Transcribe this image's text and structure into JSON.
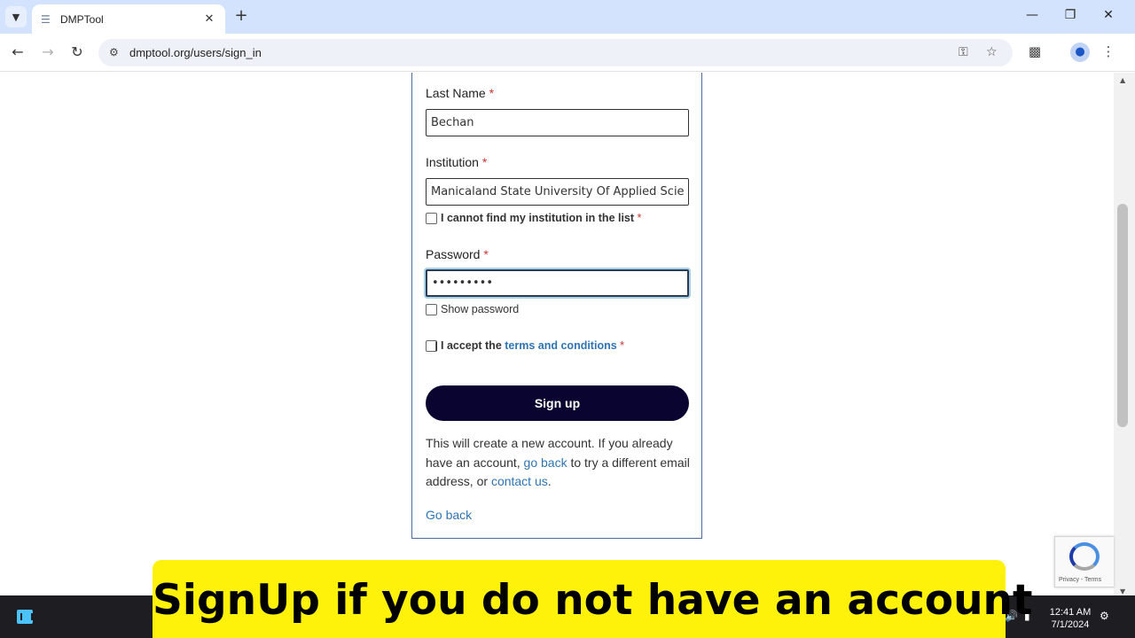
{
  "browser": {
    "tab_title": "DMPTool",
    "url": "dmptool.org/users/sign_in",
    "icons": [
      "tab-list-icon",
      "favicon-icon",
      "close-icon",
      "plus-icon",
      "minimize-icon",
      "restore-icon",
      "window-close-icon",
      "back-arrow-icon",
      "forward-arrow-icon",
      "reload-icon",
      "site-info-icon",
      "key-icon",
      "star-icon",
      "extensions-icon",
      "profile-icon",
      "kebab-menu-icon"
    ]
  },
  "form": {
    "last_name_label": "Last Name",
    "last_name_value": "Bechan",
    "institution_label": "Institution",
    "institution_value": "Manicaland State University Of Applied Scie",
    "cannot_find_label": "I cannot find my institution in the list",
    "password_label": "Password",
    "password_value": "•••••••••",
    "show_password_label": "Show password",
    "accept_prefix": "I accept the ",
    "terms_link": "terms and conditions",
    "required_marker": "*",
    "signup_button": "Sign up",
    "note_part1": "This will create a new account. If you already have an account, ",
    "note_link1": "go back",
    "note_part2": " to try a different email address, or ",
    "note_link2": "contact us",
    "note_part3": ".",
    "go_back_link": "Go back"
  },
  "recaptcha": {
    "text": "Privacy - Terms"
  },
  "taskbar": {
    "time": "12:41 AM",
    "date": "7/1/2024"
  },
  "caption": {
    "text": "SignUp if you do not have an account"
  },
  "colors": {
    "tabbar": "#d3e3fd",
    "signup_button": "#090530",
    "link": "#2e74b5",
    "required": "#c7332f",
    "caption_bg": "#fff20a"
  }
}
